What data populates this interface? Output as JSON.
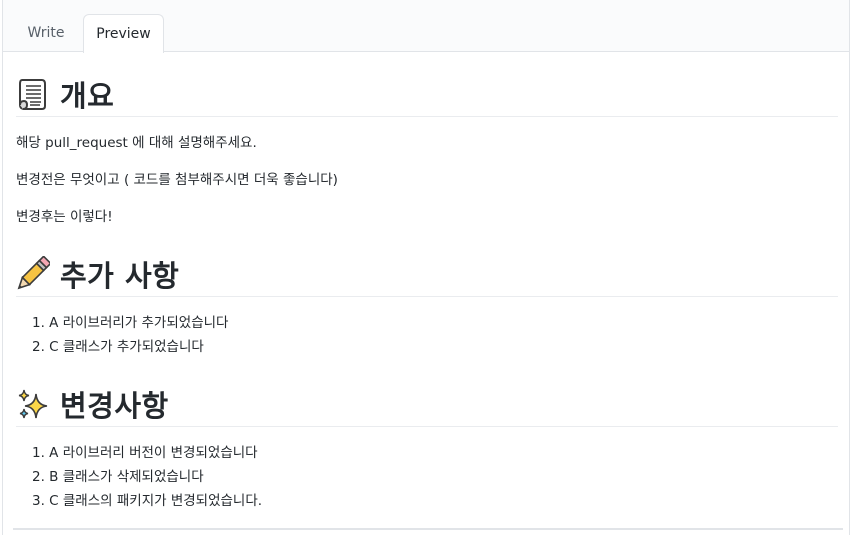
{
  "tabs": {
    "write": "Write",
    "preview": "Preview"
  },
  "sections": {
    "overview": {
      "icon": "scroll-icon",
      "title": "개요"
    },
    "added": {
      "icon": "pencil-icon",
      "title": "추가 사항"
    },
    "changes": {
      "icon": "sparkles-icon",
      "title": "변경사항"
    }
  },
  "overview_paragraphs": [
    "해당 pull_request 에 대해 설명해주세요.",
    "변경전은 무엇이고 ( 코드를 첨부해주시면 더욱 좋습니다)",
    "변경후는 이렇다!"
  ],
  "added_items": [
    "1. A 라이브러리가 추가되었습니다",
    "2. C 클래스가 추가되었습니다"
  ],
  "change_items": [
    "1. A 라이브러리 버전이 변경되었습니다",
    "2. B 클래스가 삭제되었습니다",
    "3. C 클래스의 패키지가 변경되었습니다."
  ],
  "colors": {
    "text": "#24292e",
    "tab_inactive": "#586069",
    "border": "#e1e4e8"
  }
}
